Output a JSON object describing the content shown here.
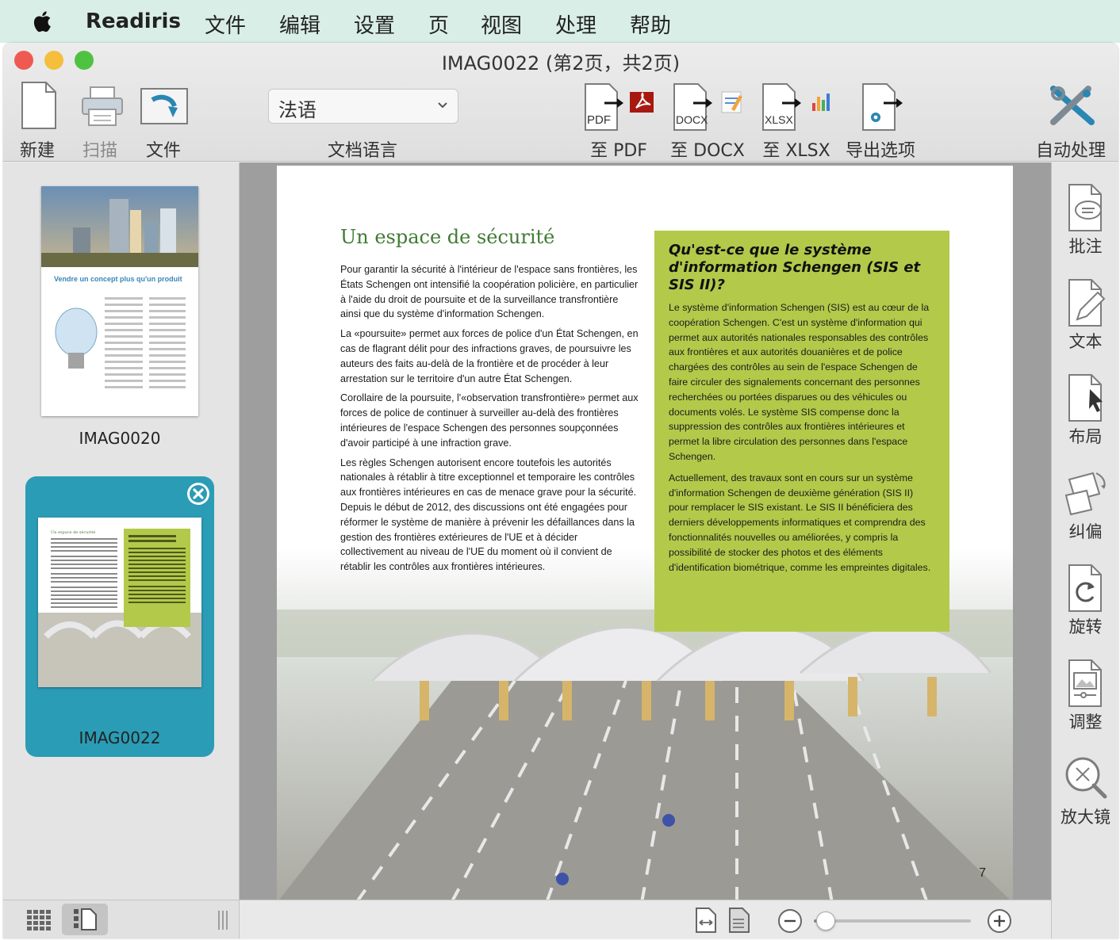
{
  "menubar": {
    "app_name": "Readiris",
    "items": [
      "文件",
      "编辑",
      "设置",
      "页",
      "视图",
      "处理",
      "帮助"
    ]
  },
  "window": {
    "title": "IMAG0022 (第2页，共2页)"
  },
  "toolbar": {
    "new_label": "新建",
    "scan_label": "扫描",
    "file_label": "文件",
    "language_value": "法语",
    "language_label": "文档语言",
    "to_pdf_label": "至 PDF",
    "to_docx_label": "至 DOCX",
    "to_xlsx_label": "至 XLSX",
    "export_options_label": "导出选项",
    "auto_process_label": "自动处理",
    "pdf_badge": "PDF",
    "docx_badge": "DOCX",
    "xlsx_badge": "XLSX"
  },
  "sidebar": {
    "pages": [
      {
        "name": "IMAG0020",
        "selected": false,
        "caption": "Vendre un concept plus qu'un produit"
      },
      {
        "name": "IMAG0022",
        "selected": true,
        "caption": "Un espace de sécurité"
      }
    ]
  },
  "document": {
    "heading": "Un espace de sécurité",
    "paragraphs": [
      "Pour garantir la sécurité à l'intérieur de l'espace sans frontières, les États Schengen ont intensifié la coopération policière, en particulier à l'aide du droit de poursuite et de la surveillance transfrontière ainsi que du système d'information Schengen.",
      "La «poursuite» permet aux forces de police d'un État Schengen, en cas de flagrant délit pour des infractions graves, de poursuivre les auteurs des faits au-delà de la frontière et de procéder à leur arrestation sur le territoire d'un autre État Schengen.",
      "Corollaire de la poursuite, l'«observation transfrontière» permet aux forces de police de continuer à surveiller au-delà des frontières intérieures de l'espace Schengen des personnes soupçonnées d'avoir participé à une infraction grave.",
      "Les règles Schengen autorisent encore toutefois les autorités nationales à rétablir à titre exceptionnel et temporaire les contrôles aux frontières intérieures en cas de menace grave pour la sécurité. Depuis le début de 2012, des discussions ont été engagées pour réformer le système de manière à prévenir les défaillances dans la gestion des frontières extérieures de l'UE et à décider collectivement au niveau de l'UE du moment où il convient de rétablir les contrôles aux frontières intérieures."
    ],
    "box_title": "Qu'est-ce que le système d'information Schengen (SIS et SIS II)?",
    "box_paragraphs": [
      "Le système d'information Schengen (SIS) est au cœur de la coopération Schengen. C'est un système d'information qui permet aux autorités nationales responsables des contrôles aux frontières et aux autorités douanières et de police chargées des contrôles au sein de l'espace Schengen de faire circuler des signalements concernant des personnes recherchées ou portées disparues ou des véhicules ou documents volés. Le système SIS compense donc la suppression des contrôles aux frontières intérieures et permet la libre circulation des personnes dans l'espace Schengen.",
      "Actuellement, des travaux sont en cours sur un système d'information Schengen de deuxième génération (SIS II) pour remplacer le SIS existant. Le SIS II bénéficiera des derniers développements informatiques et comprendra des fonctionnalités nouvelles ou améliorées, y compris la possibilité de stocker des photos et des éléments d'identification biométrique, comme les empreintes digitales."
    ],
    "page_number": "7"
  },
  "right_tools": [
    {
      "label": "批注",
      "icon": "annotation-icon"
    },
    {
      "label": "文本",
      "icon": "text-pencil-icon"
    },
    {
      "label": "布局",
      "icon": "layout-cursor-icon"
    },
    {
      "label": "纠偏",
      "icon": "deskew-icon"
    },
    {
      "label": "旋转",
      "icon": "rotate-icon"
    },
    {
      "label": "调整",
      "icon": "adjust-image-icon"
    },
    {
      "label": "放大镜",
      "icon": "magnifier-icon"
    }
  ],
  "zoom": {
    "level": 0.02
  },
  "colors": {
    "menubar_bg": "#d9eee6",
    "selected_thumb": "#2b9cb6",
    "box_green": "#b2c94a",
    "heading_green": "#3f7b34"
  }
}
